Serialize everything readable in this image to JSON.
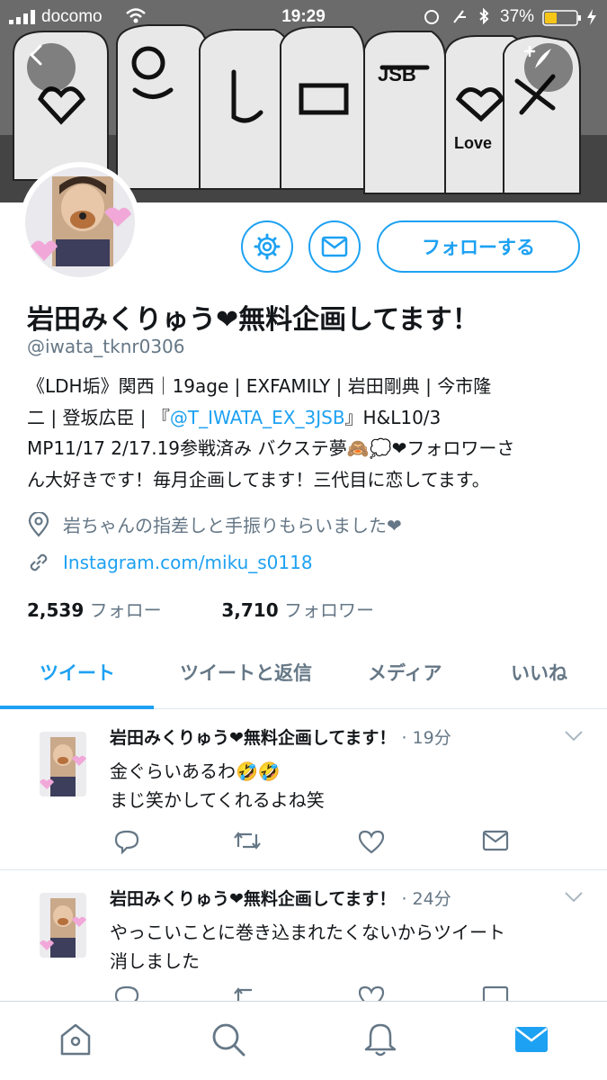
{
  "status_bar": {
    "carrier": "docomo",
    "time": "19:29",
    "battery": "37%"
  },
  "header": {
    "back_icon": "chevron-left-icon",
    "compose_icon": "compose-plus-icon"
  },
  "profile": {
    "name": "岩田みくりゅう❤無料企画してます！",
    "handle": "@iwata_tknr0306",
    "follow_label": "フォローする",
    "bio_line1": "《LDH垢》関西｜19age | EXFAMILY | 岩田剛典 | 今市隆",
    "bio_line2_pre": "二 | 登坂広臣 | 『",
    "bio_mention": "@T_IWATA_EX_3JSB",
    "bio_line2_post": "』H&L10/3",
    "bio_line3": "MP11/17 2/17.19参戦済み バクステ夢🙈💭❤フォロワーさ",
    "bio_line4": "ん大好きです！毎月企画してます！三代目に恋してます。",
    "location": "岩ちゃんの指差しと手振りもらいました❤",
    "url": "Instagram.com/miku_s0118",
    "following_count": "2,539",
    "following_label": "フォロー",
    "followers_count": "3,710",
    "followers_label": "フォロワー"
  },
  "tabs": [
    {
      "label": "ツイート",
      "active": true
    },
    {
      "label": "ツイートと返信",
      "active": false
    },
    {
      "label": "メディア",
      "active": false
    },
    {
      "label": "いいね",
      "active": false
    }
  ],
  "tweets": [
    {
      "author": "岩田みくりゅう❤無料企画してます！",
      "time": "· 19分",
      "line1": "金ぐらいあるわ🤣🤣",
      "line2": "まじ笑かしてくれるよね笑"
    },
    {
      "author": "岩田みくりゅう❤無料企画してます！",
      "time": "· 24分",
      "line1": "やっこいことに巻き込まれたくないからツイート",
      "line2": "消しました"
    }
  ],
  "colors": {
    "accent": "#1da1f2",
    "secondary_text": "#657786",
    "divider": "#e1e8ed"
  }
}
